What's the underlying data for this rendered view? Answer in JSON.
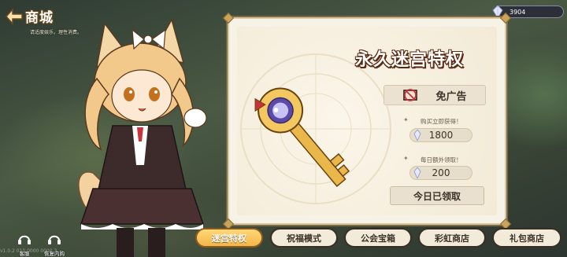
{
  "header": {
    "title": "商城",
    "subtitle": "请适度娱乐，理性消费。"
  },
  "currency": {
    "icon": "crystal-icon",
    "value": "3904"
  },
  "product": {
    "title": "永久迷宫特权",
    "no_ads_label": "免广告",
    "purchase_note": "购买立即获得！",
    "purchase_amount": "1800",
    "daily_note": "每日额外领取！",
    "daily_amount": "200",
    "collect_label": "今日已领取"
  },
  "tabs": [
    {
      "label": "迷宫特权",
      "active": true
    },
    {
      "label": "祝福模式",
      "active": false
    },
    {
      "label": "公会宝箱",
      "active": false
    },
    {
      "label": "彩虹商店",
      "active": false
    },
    {
      "label": "礼包商店",
      "active": false
    }
  ],
  "corner_buttons": [
    {
      "label": "客服",
      "icon": "headset-icon"
    },
    {
      "label": "恢复内购",
      "icon": "headset-icon"
    }
  ],
  "version_text": "v1.0.2 010 0000 0000 3"
}
